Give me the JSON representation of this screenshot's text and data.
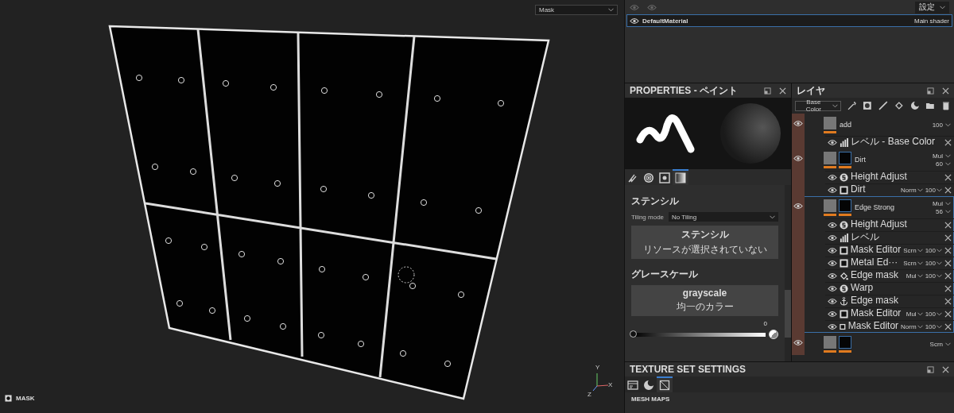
{
  "viewport": {
    "display_mode": "Mask",
    "channel_label": "MASK",
    "axes": [
      "Y",
      "X",
      "Z"
    ]
  },
  "texture_set_list": {
    "settings_button": "設定",
    "items": [
      {
        "name": "DefaultMaterial",
        "shader": "Main shader",
        "selected": true
      }
    ]
  },
  "properties": {
    "title": "PROPERTIES - ペイント",
    "tabs": [
      {
        "kind": "brush",
        "selected": false
      },
      {
        "kind": "alpha",
        "selected": false
      },
      {
        "kind": "stencil",
        "selected": false
      },
      {
        "kind": "material",
        "selected": true
      }
    ],
    "stencil": {
      "title": "ステンシル",
      "tiling_label": "Tiling mode",
      "tiling_value": "No Tiling",
      "resource_title": "ステンシル",
      "resource_status": "リソースが選択されていない"
    },
    "grayscale": {
      "title": "グレースケール",
      "name": "grayscale",
      "subtitle": "均一のカラー",
      "value": "0",
      "level": 0
    }
  },
  "layers": {
    "title": "レイヤ",
    "channel": "Base Color",
    "items": [
      {
        "name": "add",
        "opacity": "100",
        "selected": false,
        "has_mask": false,
        "children": [
          {
            "kind": "levels",
            "name": "レベル - Base Color"
          }
        ]
      },
      {
        "name": "Dirt",
        "blend": "Mul",
        "opacity": "60",
        "selected": false,
        "has_mask": true,
        "children": [
          {
            "kind": "filter",
            "name": "Height Adjust"
          },
          {
            "kind": "paint",
            "name": "Dirt",
            "blend": "Norm",
            "opacity": "100"
          }
        ]
      },
      {
        "name": "Edge Strong",
        "blend": "Mul",
        "opacity": "56",
        "selected": true,
        "has_mask": true,
        "children": [
          {
            "kind": "filter",
            "name": "Height Adjust"
          },
          {
            "kind": "levels",
            "name": "レベル"
          },
          {
            "kind": "paint",
            "name": "Mask Editor",
            "blend": "Scrn",
            "opacity": "100"
          },
          {
            "kind": "paint",
            "name": "Metal Ed···",
            "blend": "Scrn",
            "opacity": "100"
          },
          {
            "kind": "generator",
            "name": "Edge mask",
            "blend": "Mul",
            "opacity": "100"
          },
          {
            "kind": "filter",
            "name": "Warp"
          },
          {
            "kind": "anchor",
            "name": "Edge mask"
          },
          {
            "kind": "paint",
            "name": "Mask Editor",
            "blend": "Mul",
            "opacity": "100"
          },
          {
            "kind": "paint",
            "name": "Mask Editor",
            "blend": "Norm",
            "opacity": "100"
          }
        ]
      },
      {
        "blend": "Scrn",
        "selected": false,
        "has_mask": true
      }
    ]
  },
  "texture_set_settings": {
    "title": "TEXTURE SET SETTINGS",
    "tabs": [
      {
        "kind": "settings",
        "selected": false
      },
      {
        "kind": "shader",
        "selected": false
      },
      {
        "kind": "mesh",
        "selected": true
      }
    ],
    "section": "MESH MAPS"
  }
}
